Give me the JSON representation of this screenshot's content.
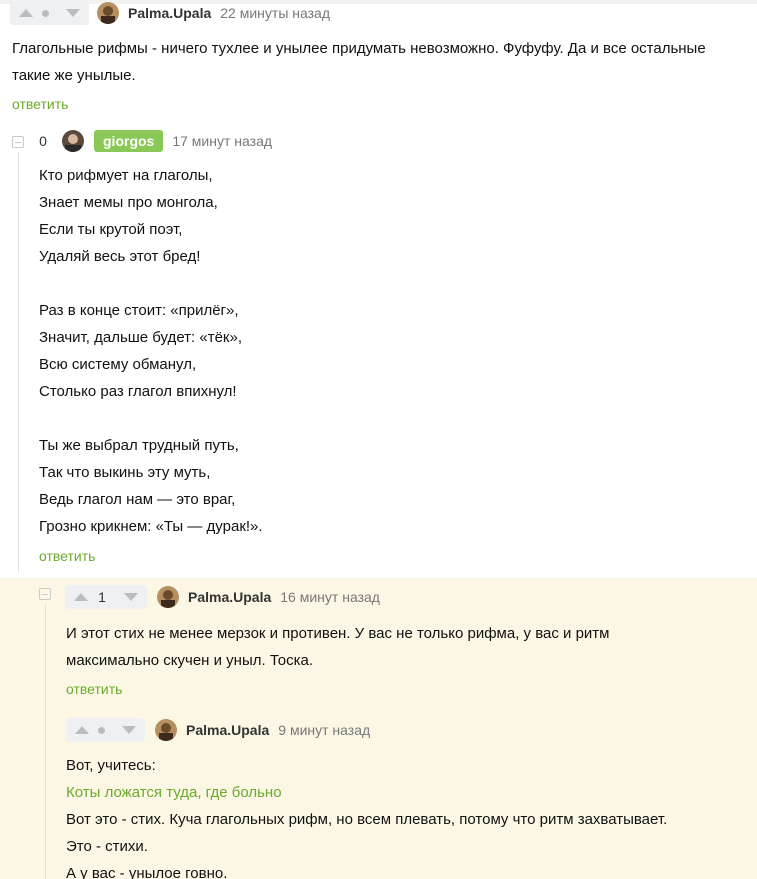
{
  "comment1": {
    "username": "Palma.Upala",
    "time": "22 минуты назад",
    "text_lines": [
      "Глагольные рифмы - ничего тухлее и унылее придумать невозможно. Фуфуфу. Да и все остальные",
      "такие же унылые."
    ],
    "reply_label": "ответить"
  },
  "comment2": {
    "rating": "0",
    "username": "giorgos",
    "time": "17 минут назад",
    "poem": [
      "Кто рифмует на глаголы,",
      "Знает мемы про монгола,",
      "Если ты крутой поэт,",
      "Удаляй весь этот бред!",
      "",
      "Раз в конце стоит: «прилёг»,",
      "Значит, дальше будет: «тёк»,",
      "Всю систему обманул,",
      "Столько раз глагол впихнул!",
      "",
      "Ты же выбрал трудный путь,",
      "Так что выкинь эту муть,",
      "Ведь глагол нам — это враг,",
      "Грозно крикнем: «Ты — дурак!»."
    ],
    "reply_label": "ответить"
  },
  "comment3": {
    "rating": "1",
    "username": "Palma.Upala",
    "time": "16 минут назад",
    "text_lines": [
      "И этот стих не менее мерзок и противен. У вас не только рифма, у вас и ритм",
      "максимально скучен и уныл. Тоска."
    ],
    "reply_label": "ответить"
  },
  "comment4": {
    "username": "Palma.Upala",
    "time": "9 минут назад",
    "line1": "Вот, учитесь:",
    "link": "Коты ложатся туда, где больно",
    "line3": "Вот это - стих. Куча глагольных рифм, но всем плевать, потому что ритм захватывает.",
    "line4": "Это - стихи.",
    "line5": "А у вас - унылое говно."
  },
  "colors": {
    "accent_green": "#6aaa2c",
    "badge_green": "#8ac858",
    "highlight_bg": "#fcf7e5"
  },
  "icons": [
    "arrow-up-icon",
    "arrow-down-icon",
    "dot-icon",
    "collapse-icon",
    "avatar"
  ]
}
